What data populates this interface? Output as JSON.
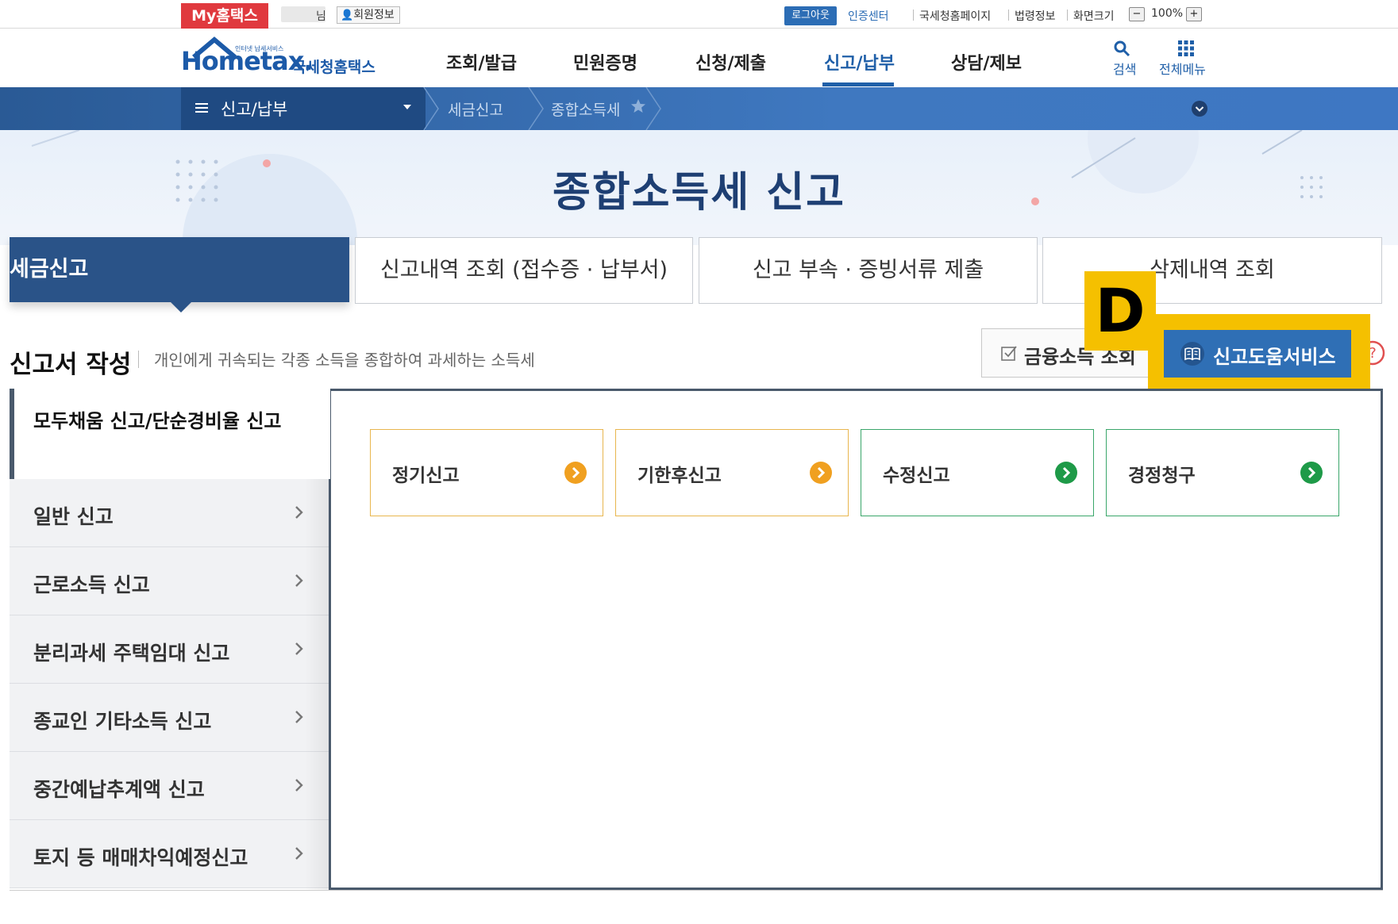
{
  "utility_bar": {
    "my_hometax": "My홈택스",
    "user_suffix": "님",
    "member_info": "회원정보",
    "logout": "로그아웃",
    "cert_center": "인증센터",
    "links": [
      "국세청홈페이지",
      "법령정보",
      "화면크기"
    ],
    "zoom_minus": "−",
    "zoom_level": "100%",
    "zoom_plus": "+"
  },
  "header": {
    "logo_text": "Hometax.",
    "logo_small": "인터넷 납세서비스",
    "logo_kor": "국세청홈택스",
    "gnb": [
      "조회/발급",
      "민원증명",
      "신청/제출",
      "신고/납부",
      "상담/제보"
    ],
    "gnb_active_index": 3,
    "search_label": "검색",
    "all_menu_label": "전체메뉴"
  },
  "location": {
    "menu_label": "신고/납부",
    "crumbs": [
      "세금신고",
      "종합소득세"
    ]
  },
  "hero": {
    "title": "종합소득세 신고"
  },
  "tabs": [
    {
      "label": "세금신고",
      "active": true
    },
    {
      "label": "신고내역 조회 (접수증 · 납부서)",
      "active": false
    },
    {
      "label": "신고 부속 · 증빙서류 제출",
      "active": false
    },
    {
      "label": "삭제내역 조회",
      "active": false
    }
  ],
  "section": {
    "title": "신고서 작성",
    "description": "개인에게 귀속되는 각종 소득을 종합하여 과세하는 소득세",
    "fin_income_button": "금융소득 조회",
    "help_button": "신고도움서비스",
    "help_badge": "D"
  },
  "sidebar": {
    "active_label": "모두채움 신고/단순경비율 신고",
    "items": [
      "일반 신고",
      "근로소득 신고",
      "분리과세 주택임대 신고",
      "종교인 기타소득 신고",
      "중간예납추계액 신고",
      "토지 등 매매차익예정신고"
    ]
  },
  "cards": [
    {
      "label": "정기신고",
      "color": "#f0a020",
      "border": "#e8b64e"
    },
    {
      "label": "기한후신고",
      "color": "#f0a020",
      "border": "#e8b64e"
    },
    {
      "label": "수정신고",
      "color": "#1e9a48",
      "border": "#3aa66a"
    },
    {
      "label": "경정청구",
      "color": "#1e9a48",
      "border": "#3aa66a"
    }
  ],
  "colors": {
    "brand_blue": "#1f5fa8",
    "navy": "#2a5388",
    "highlight": "#f5c000"
  }
}
